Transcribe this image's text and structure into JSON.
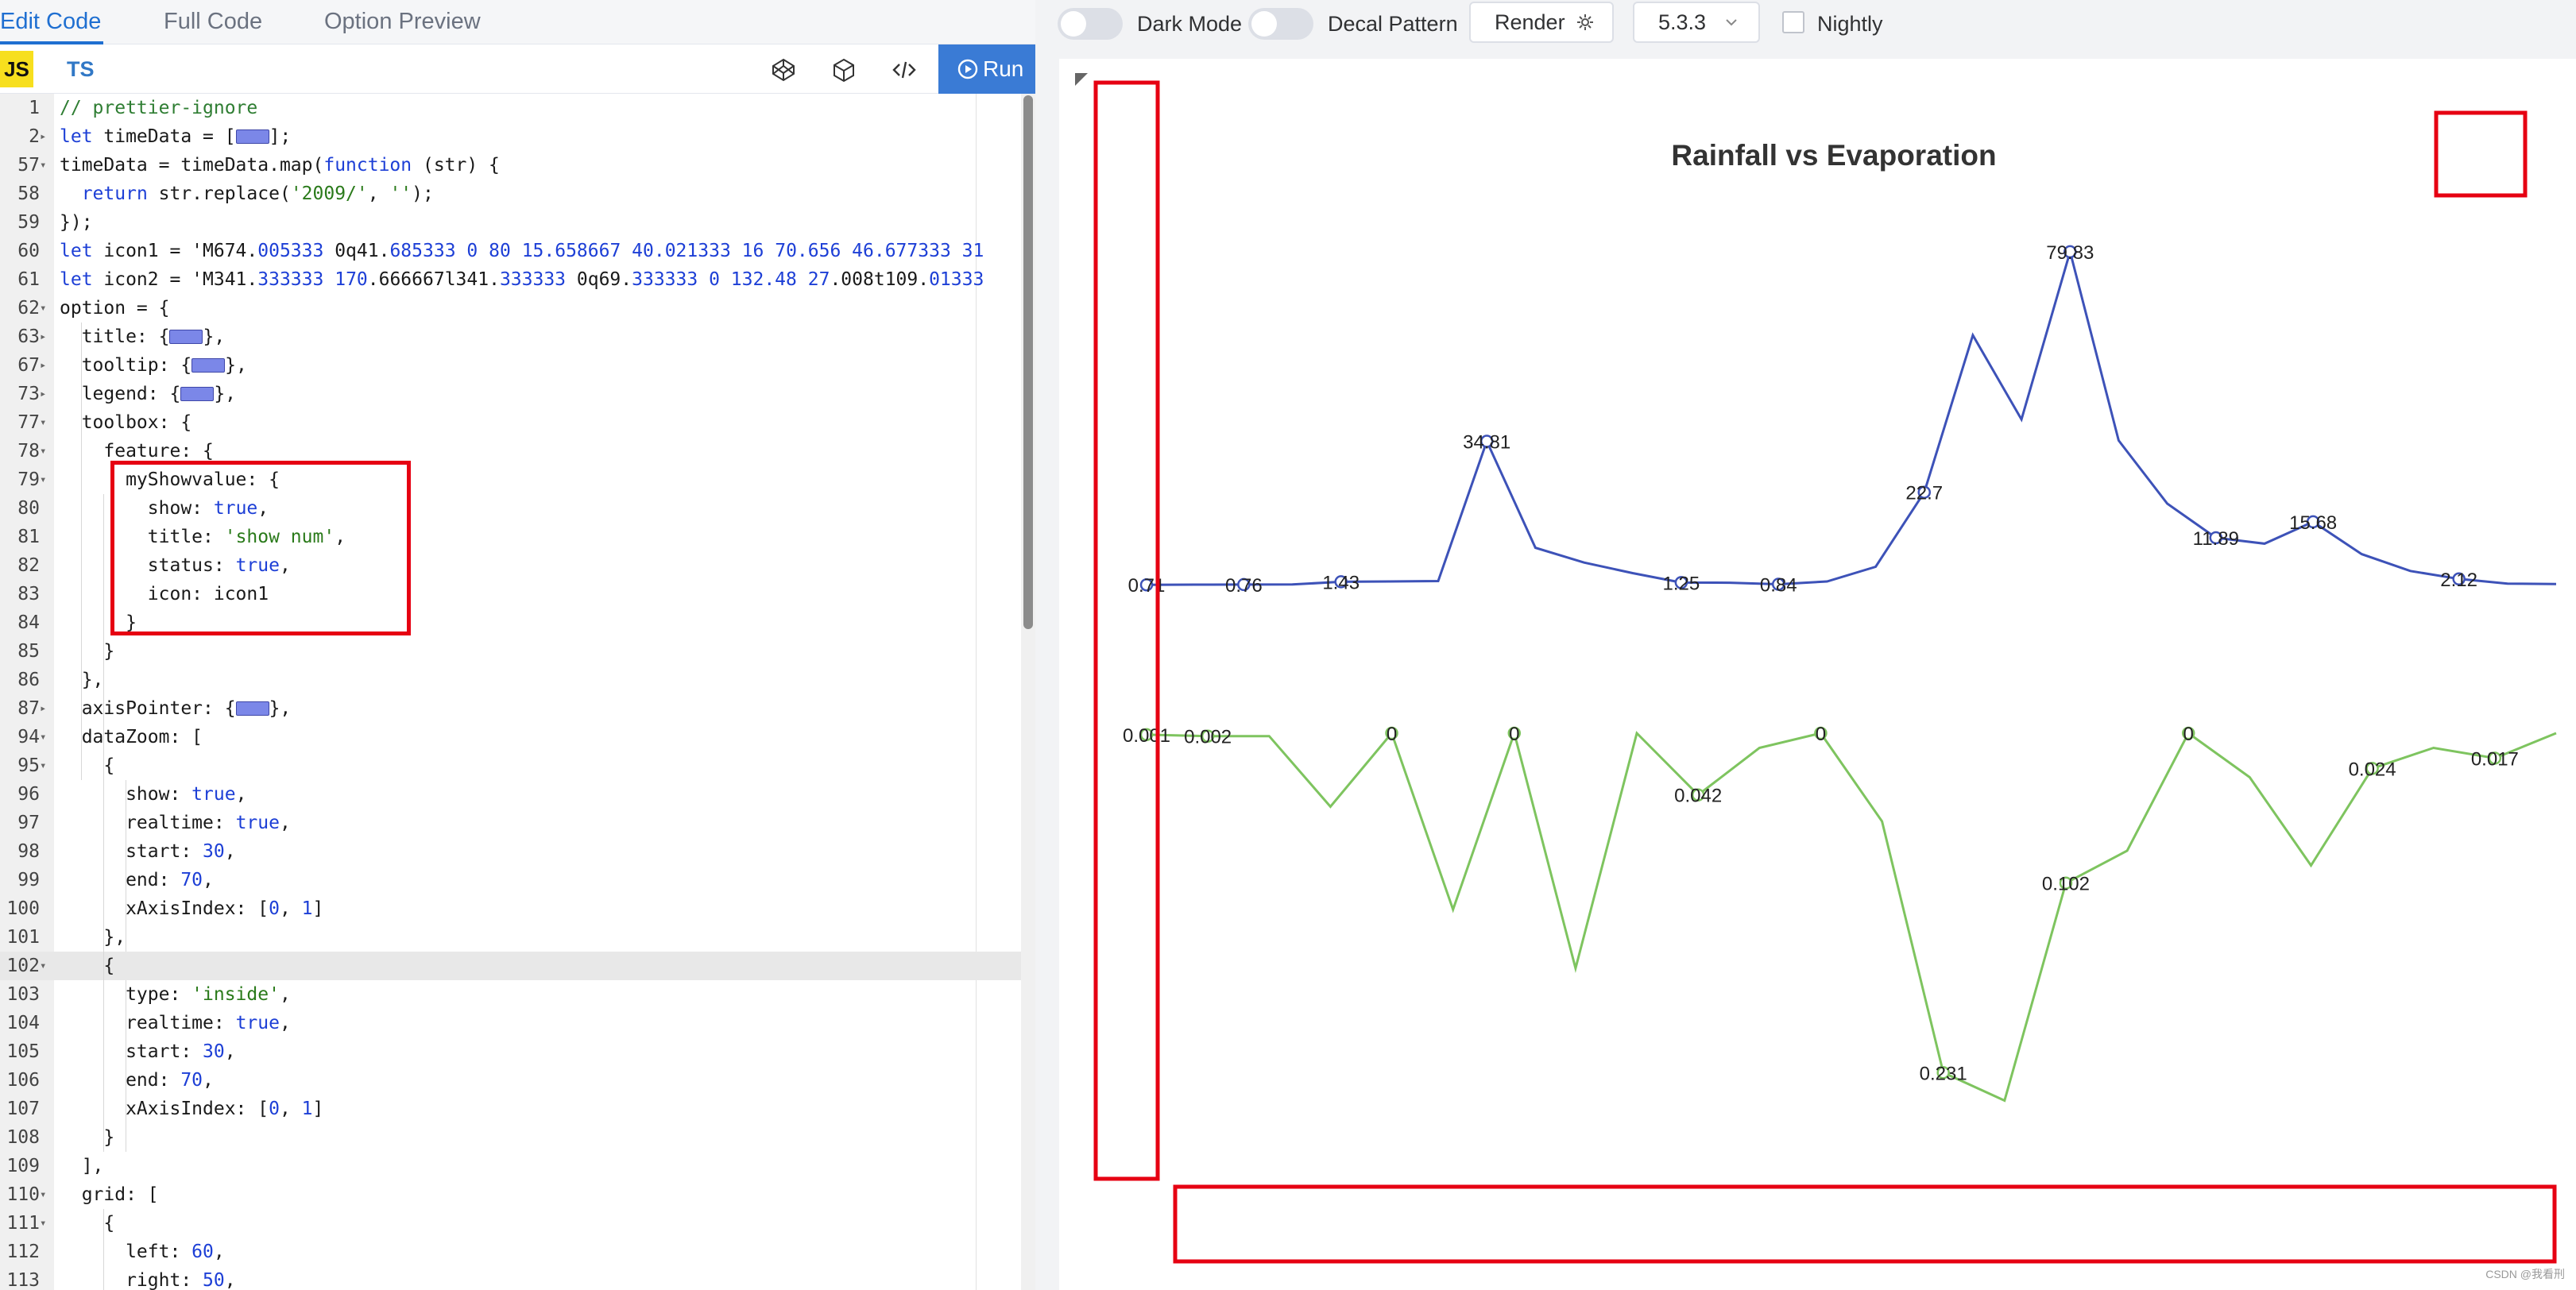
{
  "tabs": [
    {
      "label": "Edit Code",
      "active": true
    },
    {
      "label": "Full Code",
      "active": false
    },
    {
      "label": "Option Preview",
      "active": false
    }
  ],
  "editor": {
    "lang_js": "JS",
    "lang_ts": "TS",
    "tool_icons": [
      "codepen-icon",
      "codesandbox-icon",
      "embed-code-icon"
    ],
    "run_label": "Run",
    "lines": [
      {
        "n": "1",
        "fold": "",
        "text": "// prettier-ignore",
        "cls": "c-com"
      },
      {
        "n": "2",
        "fold": "▸",
        "text": "let timeData = [",
        "collapse": true,
        "after": "];"
      },
      {
        "n": "57",
        "fold": "▾",
        "text": "timeData = timeData.map(function (str) {"
      },
      {
        "n": "58",
        "fold": "",
        "text": "  return str.replace('2009/', '');"
      },
      {
        "n": "59",
        "fold": "",
        "text": "});"
      },
      {
        "n": "60",
        "fold": "",
        "text": "let icon1 = 'M674.005333 0q41.685333 0 80 15.658667 40.021333 16 70.656 46.677333 31"
      },
      {
        "n": "61",
        "fold": "",
        "text": "let icon2 = 'M341.333333 170.666667l341.333333 0q69.333333 0 132.48 27.008t109.01333"
      },
      {
        "n": "62",
        "fold": "▾",
        "text": "option = {"
      },
      {
        "n": "63",
        "fold": "▸",
        "text": "  title: {",
        "collapse": true,
        "after": "},"
      },
      {
        "n": "67",
        "fold": "▸",
        "text": "  tooltip: {",
        "collapse": true,
        "after": "},"
      },
      {
        "n": "73",
        "fold": "▸",
        "text": "  legend: {",
        "collapse": true,
        "after": "},"
      },
      {
        "n": "77",
        "fold": "▾",
        "text": "  toolbox: {"
      },
      {
        "n": "78",
        "fold": "▾",
        "text": "    feature: {"
      },
      {
        "n": "79",
        "fold": "▾",
        "text": "      myShowvalue: {"
      },
      {
        "n": "80",
        "fold": "",
        "text": "        show: true,"
      },
      {
        "n": "81",
        "fold": "",
        "text": "        title: 'show num',"
      },
      {
        "n": "82",
        "fold": "",
        "text": "        status: true,"
      },
      {
        "n": "83",
        "fold": "",
        "text": "        icon: icon1"
      },
      {
        "n": "84",
        "fold": "",
        "text": "      }"
      },
      {
        "n": "85",
        "fold": "",
        "text": "    }"
      },
      {
        "n": "86",
        "fold": "",
        "text": "  },"
      },
      {
        "n": "87",
        "fold": "▸",
        "text": "  axisPointer: {",
        "collapse": true,
        "after": "},"
      },
      {
        "n": "94",
        "fold": "▾",
        "text": "  dataZoom: ["
      },
      {
        "n": "95",
        "fold": "▾",
        "text": "    {"
      },
      {
        "n": "96",
        "fold": "",
        "text": "      show: true,"
      },
      {
        "n": "97",
        "fold": "",
        "text": "      realtime: true,"
      },
      {
        "n": "98",
        "fold": "",
        "text": "      start: 30,"
      },
      {
        "n": "99",
        "fold": "",
        "text": "      end: 70,"
      },
      {
        "n": "100",
        "fold": "",
        "text": "      xAxisIndex: [0, 1]"
      },
      {
        "n": "101",
        "fold": "",
        "text": "    },"
      },
      {
        "n": "102",
        "fold": "▾",
        "text": "    {",
        "highlight": true
      },
      {
        "n": "103",
        "fold": "",
        "text": "      type: 'inside',"
      },
      {
        "n": "104",
        "fold": "",
        "text": "      realtime: true,"
      },
      {
        "n": "105",
        "fold": "",
        "text": "      start: 30,"
      },
      {
        "n": "106",
        "fold": "",
        "text": "      end: 70,"
      },
      {
        "n": "107",
        "fold": "",
        "text": "      xAxisIndex: [0, 1]"
      },
      {
        "n": "108",
        "fold": "",
        "text": "    }"
      },
      {
        "n": "109",
        "fold": "",
        "text": "  ],"
      },
      {
        "n": "110",
        "fold": "▾",
        "text": "  grid: ["
      },
      {
        "n": "111",
        "fold": "▾",
        "text": "    {"
      },
      {
        "n": "112",
        "fold": "",
        "text": "      left: 60,"
      },
      {
        "n": "113",
        "fold": "",
        "text": "      right: 50,"
      }
    ]
  },
  "preview": {
    "dark_mode_label": "Dark Mode",
    "decal_label": "Decal Pattern",
    "render_label": "Render",
    "version": "5.3.3",
    "nightly_label": "Nightly",
    "watermark": "CSDN @我看刑",
    "colors": {
      "flow": "#3d52b8",
      "rainfall": "#7ec45f",
      "highlight_box": "#e60012"
    }
  },
  "chart_data": {
    "type": "line",
    "title": "Rainfall vs Evaporation",
    "series": [
      {
        "values": [
          0.71,
          0.76,
          0.77,
          0.8,
          1.43,
          1.5,
          1.6,
          34.81,
          9.5,
          6.0,
          3.5,
          1.25,
          1.2,
          0.84,
          1.5,
          5.0,
          22.7,
          60.0,
          40.0,
          79.83,
          35.0,
          20.0,
          11.89,
          10.5,
          15.68,
          8.0,
          4.0,
          2.12,
          1.0,
          0.9
        ],
        "labels": [
          {
            "index": 0,
            "text": "0.71"
          },
          {
            "index": 2,
            "text": "0.76"
          },
          {
            "index": 4,
            "text": "1.43"
          },
          {
            "index": 7,
            "text": "34.81"
          },
          {
            "index": 11,
            "text": "1.25"
          },
          {
            "index": 13,
            "text": "0.84"
          },
          {
            "index": 16,
            "text": "22.7"
          },
          {
            "index": 19,
            "text": "79.83"
          },
          {
            "index": 22,
            "text": "11.89"
          },
          {
            "index": 24,
            "text": "15.68"
          },
          {
            "index": 27,
            "text": "2.12"
          }
        ]
      },
      {
        "values": [
          0.001,
          0.002,
          0.002,
          0.05,
          0,
          0.12,
          0.0,
          0.16,
          0,
          0.042,
          0.01,
          0,
          0.06,
          0.231,
          0.25,
          0.102,
          0.08,
          0.0,
          0.03,
          0.09,
          0.024,
          0.01,
          0.017,
          0.0
        ],
        "labels": [
          {
            "index": 0,
            "text": "0.001"
          },
          {
            "index": 1,
            "text": "0.002"
          },
          {
            "index": 4,
            "text": "0"
          },
          {
            "index": 6,
            "text": "0"
          },
          {
            "index": 9,
            "text": "0.042"
          },
          {
            "index": 11,
            "text": "0"
          },
          {
            "index": 13,
            "text": "0.231"
          },
          {
            "index": 15,
            "text": "0.102"
          },
          {
            "index": 17,
            "text": "0"
          },
          {
            "index": 20,
            "text": "0.024"
          },
          {
            "index": 22,
            "text": "0.017"
          }
        ]
      }
    ],
    "grid": false
  }
}
